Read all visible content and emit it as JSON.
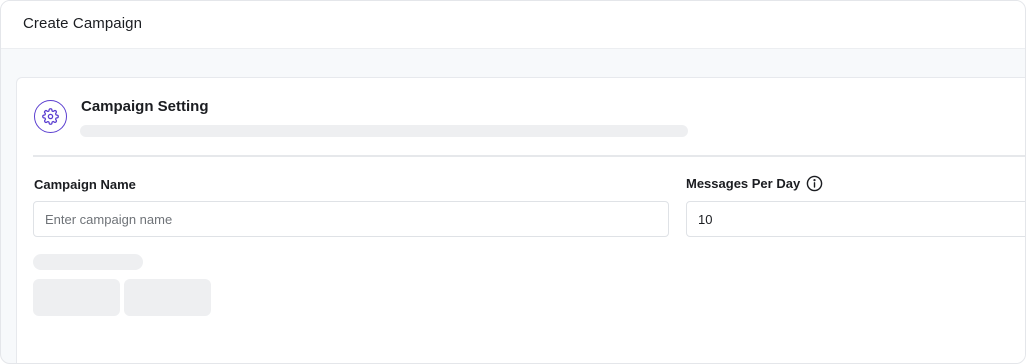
{
  "header": {
    "title": "Create Campaign"
  },
  "section": {
    "title": "Campaign Setting",
    "icon": "gear-icon",
    "accent_color": "#5b3fd0"
  },
  "form": {
    "campaign_name": {
      "label": "Campaign Name",
      "placeholder": "Enter campaign name",
      "value": ""
    },
    "messages_per_day": {
      "label": "Messages Per Day",
      "value": "10",
      "icon": "info-icon"
    }
  }
}
